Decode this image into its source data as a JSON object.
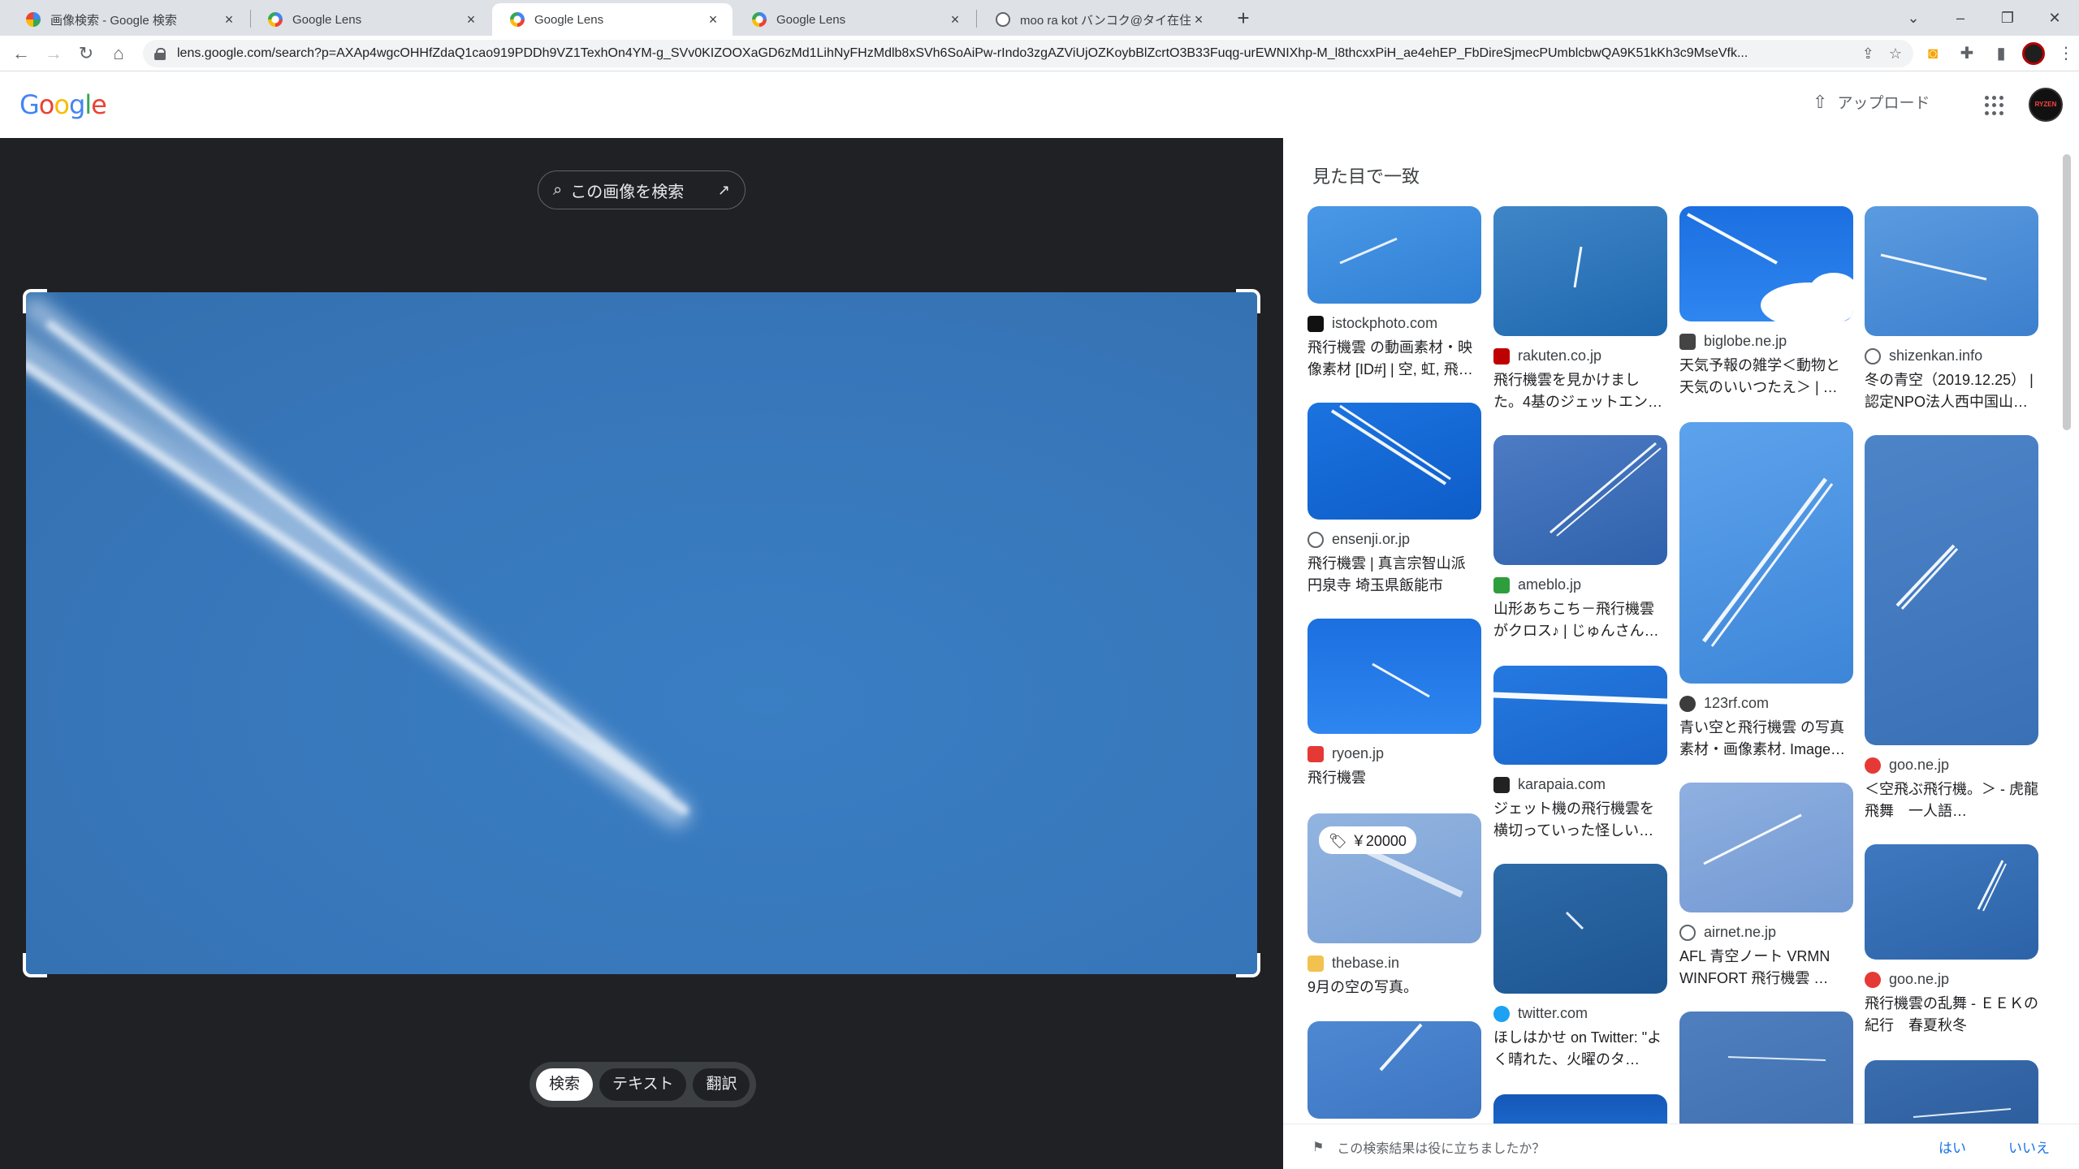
{
  "browser": {
    "tabs": [
      {
        "title": "画像検索 - Google 検索",
        "favicon": "google-icon",
        "active": false
      },
      {
        "title": "Google Lens",
        "favicon": "lens-icon",
        "active": false
      },
      {
        "title": "Google Lens",
        "favicon": "lens-icon",
        "active": true
      },
      {
        "title": "Google Lens",
        "favicon": "lens-icon",
        "active": false
      },
      {
        "title": "moo ra kot バンコク@タイ在住／ま",
        "favicon": "globe-icon",
        "active": false
      }
    ],
    "url": "lens.google.com/search?p=AXAp4wgcOHHfZdaQ1cao919PDDh9VZ1TexhOn4YM-g_SVv0KIZOOXaGD6zMd1LihNyFHzMdlb8xSVh6SoAiPw-rIndo3zgAZViUjOZKoybBlZcrtO3B33Fuqg-urEWNIXhp-M_l8thcxxPiH_ae4ehEP_FbDireSjmecPUmblcbwQA9K51kKh3c9MseVfk..."
  },
  "header": {
    "logo": "Google",
    "upload_label": "アップロード"
  },
  "lens": {
    "search_image_label": "この画像を検索",
    "modes": [
      "検索",
      "テキスト",
      "翻訳"
    ]
  },
  "results": {
    "heading": "見た目で一致",
    "cards": [
      {
        "site": "istockphoto.com",
        "desc": "飛行機雲 の動画素材・映像素材 [ID#] | 空, 虹, 飛…",
        "icon": "istock-icon"
      },
      {
        "site": "ensenji.or.jp",
        "desc": "飛行機雲 | 真言宗智山派 円泉寺 埼玉県飯能市",
        "icon": "globe-icon"
      },
      {
        "site": "ryoen.jp",
        "desc": "飛行機雲",
        "icon": "ryoen-icon"
      },
      {
        "site": "thebase.in",
        "desc": "9月の空の写真。",
        "icon": "thebase-icon",
        "price": "￥20000"
      },
      {
        "site": "rakuten.co.jp",
        "desc": "飛行機雲を見かけました。4基のジェットエン…",
        "icon": "rakuten-icon"
      },
      {
        "site": "ameblo.jp",
        "desc": "山形あちこち－飛行機雲がクロス♪ | じゅんさん…",
        "icon": "ameblo-icon"
      },
      {
        "site": "karapaia.com",
        "desc": "ジェット機の飛行機雲を横切っていった怪しい…",
        "icon": "karapaia-icon"
      },
      {
        "site": "twitter.com",
        "desc": "ほしはかせ on Twitter: \"よく晴れた、火曜のタ…",
        "icon": "twitter-icon"
      },
      {
        "site": "biglobe.ne.jp",
        "desc": "天気予報の雑学＜動物と天気のいいつたえ＞ | …",
        "icon": "biglobe-icon"
      },
      {
        "site": "123rf.com",
        "desc": "青い空と飛行機雲 の写真素材・画像素材. Image…",
        "icon": "123rf-icon"
      },
      {
        "site": "airnet.ne.jp",
        "desc": "AFL 青空ノート VRMN WINFORT 飛行機雲 …",
        "icon": "globe-icon"
      },
      {
        "site": "shizenkan.info",
        "desc": "冬の青空（2019.12.25） | 認定NPO法人西中国山…",
        "icon": "globe-icon"
      },
      {
        "site": "goo.ne.jp",
        "desc": "＜空飛ぶ飛行機。＞ - 虎龍　飛舞　一人語…",
        "icon": "goo-icon"
      },
      {
        "site": "goo.ne.jp",
        "desc": "飛行機雲の乱舞 - ＥＥＫの紀行　春夏秋冬",
        "icon": "goo-icon"
      }
    ]
  },
  "feedback": {
    "question": "この検索結果は役に立ちましたか？",
    "yes": "はい",
    "no": "いいえ"
  },
  "colors": {
    "lens_bg": "#202124",
    "sky_blue": "#3776b9",
    "link_blue": "#1a73e8"
  }
}
